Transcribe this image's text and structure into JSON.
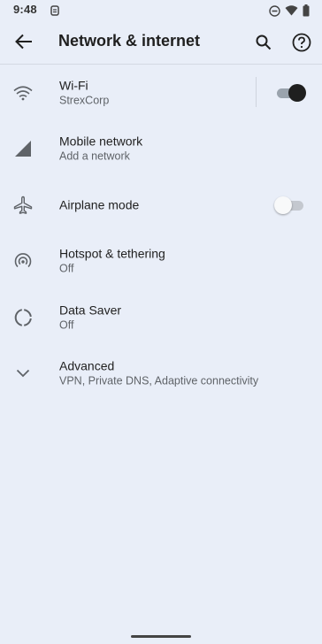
{
  "status_bar": {
    "time": "9:48"
  },
  "app_bar": {
    "title": "Network & internet"
  },
  "items": [
    {
      "id": "wifi",
      "title": "Wi-Fi",
      "subtitle": "StrexCorp",
      "toggle": true,
      "icon": "wifi-icon"
    },
    {
      "id": "mobile",
      "title": "Mobile network",
      "subtitle": "Add a network",
      "icon": "signal-icon"
    },
    {
      "id": "airplane",
      "title": "Airplane mode",
      "subtitle": "",
      "toggle": false,
      "icon": "airplane-icon"
    },
    {
      "id": "hotspot",
      "title": "Hotspot & tethering",
      "subtitle": "Off",
      "icon": "hotspot-icon"
    },
    {
      "id": "datasaver",
      "title": "Data Saver",
      "subtitle": "Off",
      "icon": "data-saver-icon"
    },
    {
      "id": "advanced",
      "title": "Advanced",
      "subtitle": "VPN, Private DNS, Adaptive connectivity",
      "icon": "chevron-down-icon"
    }
  ],
  "colors": {
    "background": "#e9eef8",
    "text_primary": "#1f1f1f",
    "text_secondary": "#5f6368"
  }
}
